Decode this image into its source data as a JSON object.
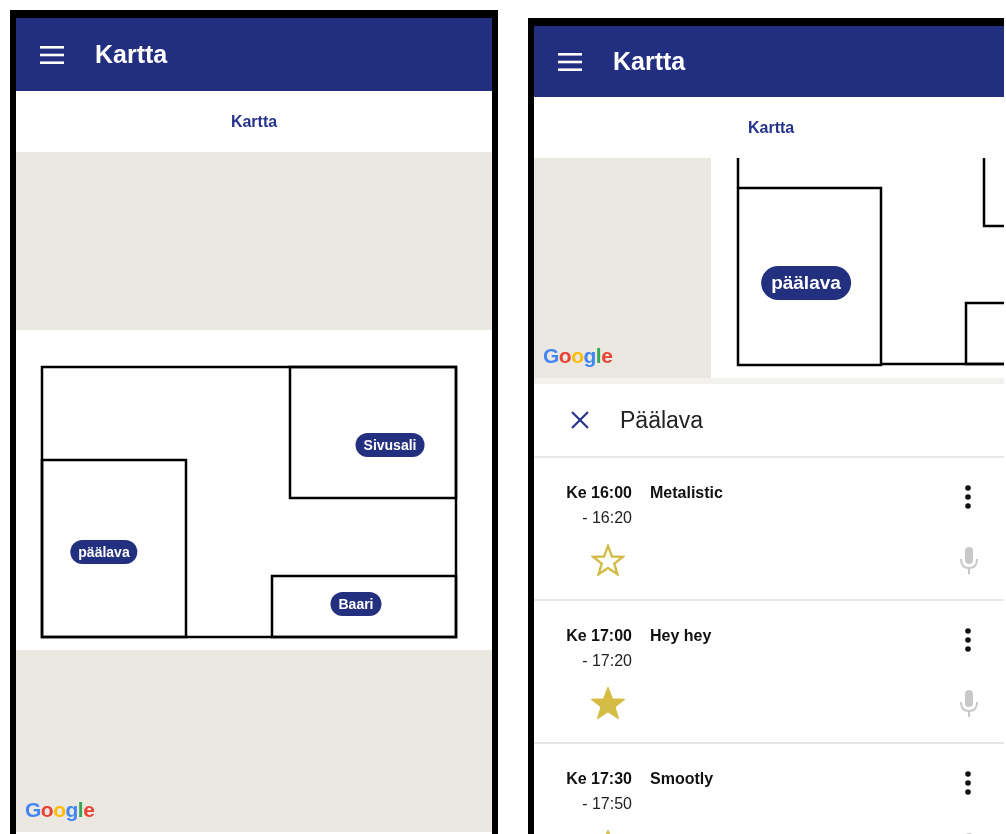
{
  "screens": [
    {
      "app_bar": {
        "title": "Kartta"
      },
      "tabs": [
        {
          "label": "Kartta",
          "selected": true
        }
      ],
      "map": {
        "attribution": "Google",
        "rooms": [
          {
            "label": "Sivusali"
          },
          {
            "label": "päälava"
          },
          {
            "label": "Baari"
          }
        ]
      }
    },
    {
      "app_bar": {
        "title": "Kartta"
      },
      "tabs": [
        {
          "label": "Kartta",
          "selected": true
        }
      ],
      "map": {
        "attribution": "Google",
        "rooms": [
          {
            "label": "päälava"
          }
        ]
      },
      "panel": {
        "title": "Päälava",
        "performances": [
          {
            "start": "Ke 16:00",
            "end": "- 16:20",
            "name": "Metalistic",
            "favorite": false
          },
          {
            "start": "Ke 17:00",
            "end": "- 17:20",
            "name": "Hey hey",
            "favorite": true
          },
          {
            "start": "Ke 17:30",
            "end": "- 17:50",
            "name": "Smootly"
          }
        ]
      }
    }
  ]
}
